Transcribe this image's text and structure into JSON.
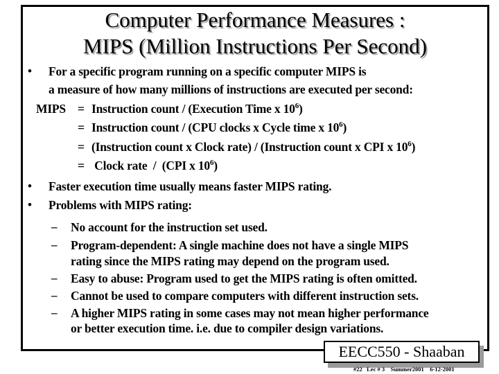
{
  "slide": {
    "title_line1": "Computer Performance Measures :",
    "title_line2": "MIPS (Million Instructions Per Second)",
    "bullet_symbol": "•",
    "dash_symbol": "–",
    "bullets": [
      {
        "line1": "For a specific program running on a specific computer MIPS is",
        "line2": "a measure of how many millions of instructions are executed per second:"
      },
      {
        "text": "Faster execution time usually means faster MIPS rating."
      },
      {
        "text": "Problems with MIPS rating:"
      }
    ],
    "formula": {
      "lhs": "MIPS",
      "eq": "=",
      "lines": [
        {
          "pre": "Instruction count  /  (Execution Time x 10",
          "exp": "6",
          "post": ")"
        },
        {
          "pre": "Instruction count  /  (CPU clocks x Cycle time x 10",
          "exp": "6",
          "post": ")"
        },
        {
          "pre": "(Instruction count  x  Clock rate)  /  (Instruction count  x  CPI x 10",
          "exp": "6",
          "post": ")"
        },
        {
          "pre": " Clock rate  /  (CPI x 10",
          "exp": "6",
          "post": ")"
        }
      ]
    },
    "problems": [
      {
        "line1": "No account for the instruction set used."
      },
      {
        "line1": "Program-dependent: A single machine does not have a single MIPS",
        "line2": "rating since the MIPS rating may depend on the program used."
      },
      {
        "line1": "Easy to abuse:  Program used to get the MIPS rating is often omitted."
      },
      {
        "line1": "Cannot be used to compare computers with different instruction sets."
      },
      {
        "line1": "A higher MIPS rating in some cases may not mean higher performance",
        "line2": "or better execution time.  i.e. due to compiler design variations."
      }
    ]
  },
  "footer": {
    "course": "EECC550 - Shaaban",
    "meta": "#22   Lec # 3    Summer2001    6-12-2001"
  }
}
